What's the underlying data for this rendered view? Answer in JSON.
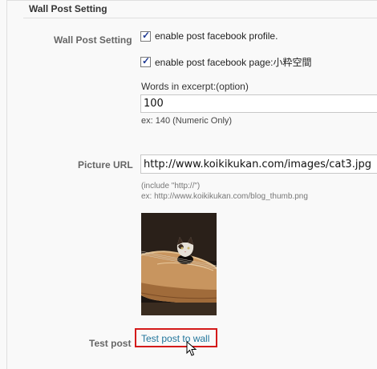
{
  "section": {
    "title": "Wall Post Setting"
  },
  "wall_post": {
    "label": "Wall Post Setting",
    "profile_checkbox": {
      "label": "enable post facebook profile.",
      "checked": true,
      "check_glyph": "✓"
    },
    "page_checkbox": {
      "label": "enable post facebook page:小粋空間",
      "checked": true,
      "check_glyph": "✓"
    },
    "excerpt": {
      "caption": "Words in excerpt:(option)",
      "value": "100",
      "hint": "ex: 140 (Numeric Only)"
    }
  },
  "picture": {
    "label": "Picture URL",
    "value": "http://www.koikikukan.com/images/cat3.jpg",
    "hint_line1": "(include \"http://\")",
    "hint_line2": "ex: http://www.koikikukan.com/blog_thumb.png"
  },
  "test": {
    "label": "Test post",
    "link_text": "Test post to wall"
  },
  "colors": {
    "link": "#21759b",
    "highlight_border": "#d41a1a"
  },
  "icons": {
    "thumbnail": "cat-guitar-photo",
    "cursor": "pointer-cursor-icon"
  }
}
